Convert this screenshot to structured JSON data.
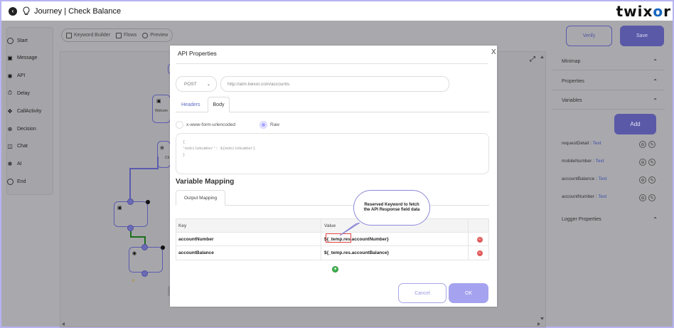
{
  "header": {
    "title": "Journey | Check Balance",
    "logo_pre": "twix",
    "logo_o": "o",
    "logo_post": "r"
  },
  "sidebar": {
    "items": [
      {
        "label": "Start"
      },
      {
        "label": "Message"
      },
      {
        "label": "API"
      },
      {
        "label": "Delay"
      },
      {
        "label": "CallActivity"
      },
      {
        "label": "Decision"
      },
      {
        "label": "Chat"
      },
      {
        "label": "AI"
      },
      {
        "label": "End"
      }
    ]
  },
  "toolbar": {
    "keyword_builder": "Keyword Builder",
    "flows": "Flows",
    "preview": "Preview",
    "verify": "Verify",
    "save": "Save"
  },
  "canvas": {
    "node_labels": [
      "Welcom",
      "Ch"
    ]
  },
  "right_panel": {
    "minimap": "Minimap",
    "properties": "Properties",
    "variables": "Variables",
    "add": "Add",
    "variables_list": [
      {
        "name": "requestDetail",
        "type": "Text"
      },
      {
        "name": "mobileNumber",
        "type": "Text"
      },
      {
        "name": "accountBalance",
        "type": "Text"
      },
      {
        "name": "accountNumber",
        "type": "Text"
      }
    ],
    "logger_properties": "Logger Properties"
  },
  "modal": {
    "title": "API Properties",
    "close": "X",
    "method": "POST",
    "url": "http://aim.twixor.com/accounts",
    "tabs": {
      "headers": "Headers",
      "body": "Body"
    },
    "radio": {
      "urlencoded": "x-www-form-urlencoded",
      "raw": "Raw"
    },
    "body_lines": [
      "{",
      "  'mobileNumber': ${mobileNumber}",
      "}"
    ],
    "variable_mapping_title": "Variable Mapping",
    "output_mapping_tab": "Output Mapping",
    "table": {
      "headers": {
        "key": "Key",
        "value": "Value"
      },
      "rows": [
        {
          "key": "accountNumber",
          "value": "${_temp.res.accountNumber}"
        },
        {
          "key": "accountBalance",
          "value": "${_temp.res.accountBalance}"
        }
      ]
    },
    "cancel": "Cancel",
    "ok": "OK"
  },
  "callout": {
    "text": "Reserved Keyword to fetch the API Response field data"
  },
  "colors": {
    "accent": "#5a59a8",
    "link": "#5b6bc4",
    "delete": "#e05b5b",
    "add": "#3fb34f",
    "highlight": "#e04040"
  }
}
